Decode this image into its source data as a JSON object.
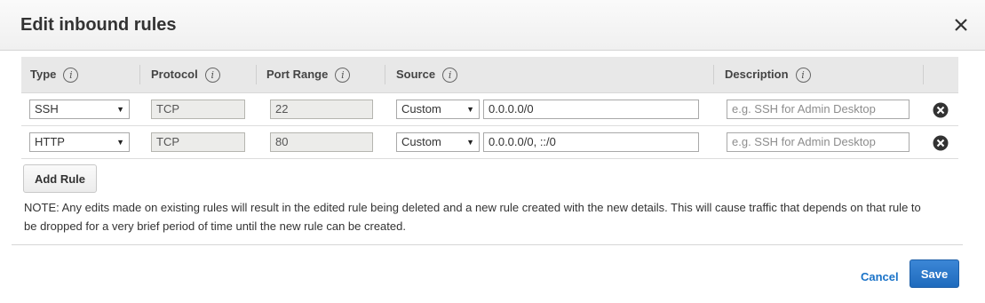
{
  "dialog": {
    "title": "Edit inbound rules",
    "close_icon": "close-icon"
  },
  "table": {
    "headers": {
      "type": "Type",
      "protocol": "Protocol",
      "port_range": "Port Range",
      "source": "Source",
      "description": "Description"
    },
    "info_glyph": "i",
    "rows": [
      {
        "type": "SSH",
        "protocol": "TCP",
        "port_range": "22",
        "source_mode": "Custom",
        "source_value": "0.0.0.0/0",
        "description_placeholder": "e.g. SSH for Admin Desktop"
      },
      {
        "type": "HTTP",
        "protocol": "TCP",
        "port_range": "80",
        "source_mode": "Custom",
        "source_value": "0.0.0.0/0, ::/0",
        "description_placeholder": "e.g. SSH for Admin Desktop"
      }
    ],
    "caret": "▼"
  },
  "actions": {
    "add_rule_label": "Add Rule",
    "note": "NOTE: Any edits made on existing rules will result in the edited rule being deleted and a new rule created with the new details. This will cause traffic that depends on that rule to be dropped for a very brief period of time until the new rule can be created.",
    "cancel_label": "Cancel",
    "save_label": "Save"
  },
  "colors": {
    "accent": "#1f6bbd",
    "link": "#1a73c8",
    "header_bg": "#e8e8e8"
  }
}
